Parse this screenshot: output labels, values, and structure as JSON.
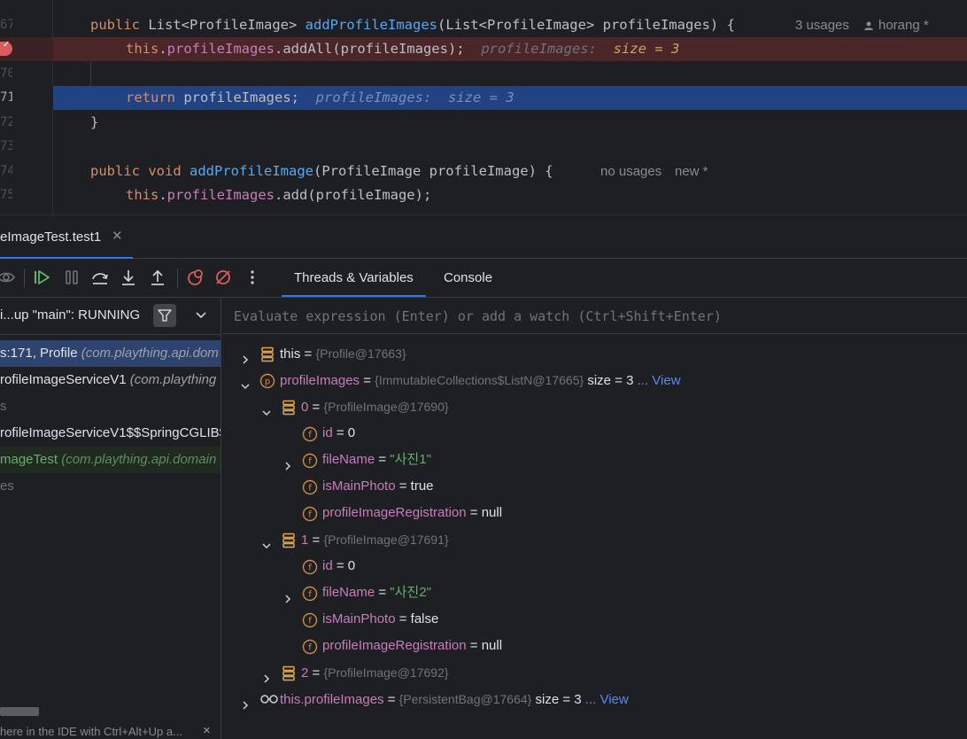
{
  "editor": {
    "lines": [
      {
        "num": "67"
      },
      {
        "num": "",
        "breakpoint": true
      },
      {
        "num": "70"
      },
      {
        "num": "71",
        "current": true
      },
      {
        "num": "72"
      },
      {
        "num": "73"
      },
      {
        "num": "74"
      },
      {
        "num": "75"
      }
    ],
    "method1": {
      "kw_public": "public",
      "ret_type": "List<ProfileImage>",
      "name": "addProfileImages",
      "params": "(List<ProfileImage> profileImages) {",
      "usages": "3 usages",
      "author_icon": "person-icon",
      "author": "horang *"
    },
    "stmt1": {
      "kw_this": "this",
      "field": "profileImages",
      "rest": ".addAll(profileImages);",
      "inline_name": "profileImages:",
      "inline_value": "size = 3"
    },
    "stmt2": {
      "kw_return": "return",
      "rest": "profileImages;",
      "inline_name": "profileImages:",
      "inline_value": "size = 3"
    },
    "close_brace": "}",
    "method2": {
      "kw_public": "public",
      "kw_void": "void",
      "name": "addProfileImage",
      "params": "(ProfileImage profileImage) {",
      "usages": "no usages",
      "author": "new *"
    },
    "stmt3": {
      "kw_this": "this",
      "field": "profileImages",
      "rest": ".add(profileImage);"
    }
  },
  "debug": {
    "run_tab": "eImageTest.test1",
    "tabs": [
      {
        "label": "Threads & Variables",
        "active": true
      },
      {
        "label": "Console",
        "active": false
      }
    ],
    "thread": "i...up \"main\": RUNNING",
    "frames": [
      {
        "method": "s:171, Profile ",
        "pkg": "(com.plaything.api.dom",
        "style": "sel"
      },
      {
        "method": "rofileImageServiceV1 ",
        "pkg": "(com.plaything",
        "style": "normal"
      },
      {
        "method": "s",
        "pkg": "",
        "style": "lib"
      },
      {
        "method": "rofileImageServiceV1$$SpringCGLIB$",
        "pkg": "",
        "style": "normal"
      },
      {
        "method": "mageTest ",
        "pkg": "(com.plaything.api.domain",
        "style": "green"
      },
      {
        "method": "es",
        "pkg": "",
        "style": "lib"
      }
    ],
    "hint": "here in the IDE with Ctrl+Alt+Up a...",
    "hint_close": "×"
  },
  "variables": {
    "eval_placeholder": "Evaluate expression (Enter) or add a watch (Ctrl+Shift+Enter)",
    "rows": [
      {
        "level": 0,
        "arrow": "right",
        "icon": "object",
        "name": "this",
        "plain": true,
        "type": "{Profile@17663}"
      },
      {
        "level": 0,
        "arrow": "down",
        "icon": "protected",
        "name": "profileImages",
        "type": "{ImmutableCollections$ListN@17665}",
        "extra": "size = 3",
        "link": "... View"
      },
      {
        "level": 1,
        "arrow": "down",
        "icon": "object",
        "name": "0",
        "type": "{ProfileImage@17690}"
      },
      {
        "level": 2,
        "arrow": "",
        "icon": "field",
        "name": "id",
        "value": "0"
      },
      {
        "level": 2,
        "arrow": "right",
        "icon": "field",
        "name": "fileName",
        "str": "\"사진1\""
      },
      {
        "level": 2,
        "arrow": "",
        "icon": "field",
        "name": "isMainPhoto",
        "value": "true"
      },
      {
        "level": 2,
        "arrow": "",
        "icon": "field",
        "name": "profileImageRegistration",
        "value": "null"
      },
      {
        "level": 1,
        "arrow": "down",
        "icon": "object",
        "name": "1",
        "type": "{ProfileImage@17691}"
      },
      {
        "level": 2,
        "arrow": "",
        "icon": "field",
        "name": "id",
        "value": "0"
      },
      {
        "level": 2,
        "arrow": "right",
        "icon": "field",
        "name": "fileName",
        "str": "\"사진2\""
      },
      {
        "level": 2,
        "arrow": "",
        "icon": "field",
        "name": "isMainPhoto",
        "value": "false"
      },
      {
        "level": 2,
        "arrow": "",
        "icon": "field",
        "name": "profileImageRegistration",
        "value": "null"
      },
      {
        "level": 1,
        "arrow": "right",
        "icon": "object",
        "name": "2",
        "type": "{ProfileImage@17692}"
      },
      {
        "level": 0,
        "arrow": "right",
        "icon": "watch",
        "name": "this.profileImages",
        "type": "{PersistentBag@17664}",
        "extra": "size = 3",
        "link": "... View"
      }
    ]
  }
}
